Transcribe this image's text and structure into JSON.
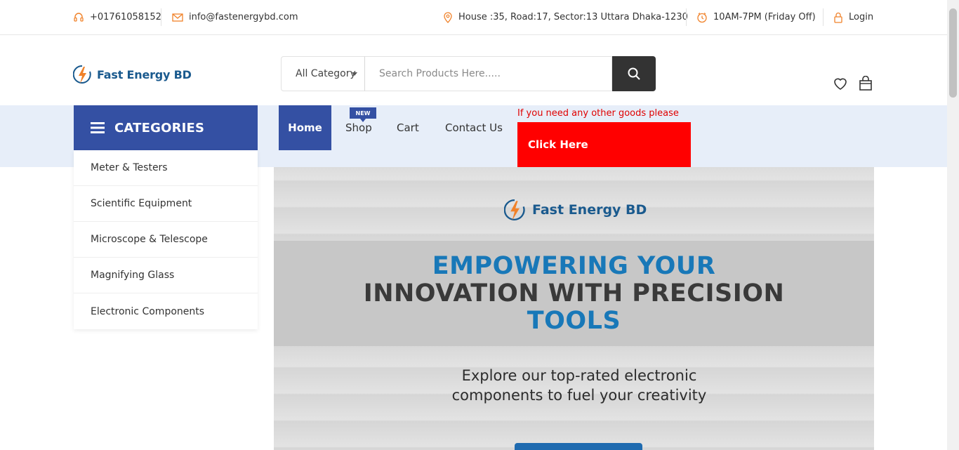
{
  "topbar": {
    "phone": "+01761058152",
    "email": "info@fastenergybd.com",
    "address": "House :35, Road:17, Sector:13 Uttara Dhaka-1230",
    "hours": "10AM-7PM (Friday Off)",
    "login": "Login"
  },
  "header": {
    "logo_text": "Fast Energy BD",
    "category_select": "All Category",
    "search_placeholder": "Search Products Here....."
  },
  "nav": {
    "categories_label": "CATEGORIES",
    "items": [
      "Home",
      "Shop",
      "Cart",
      "Contact Us"
    ],
    "new_badge": "NEW",
    "promo_text": "If you need any other goods please",
    "promo_button": "Click Here"
  },
  "categories": [
    "Meter & Testers",
    "Scientific Equipment",
    "Microscope & Telescope",
    "Magnifying Glass",
    "Electronic Components"
  ],
  "banner": {
    "logo_text": "Fast Energy BD",
    "headline_1": "EMPOWERING YOUR",
    "headline_2": "INNOVATION WITH PRECISION",
    "headline_3": "TOOLS",
    "subtext_1": "Explore our top-rated electronic",
    "subtext_2": "components to fuel your creativity"
  },
  "colors": {
    "brand_blue": "#3450a3",
    "nav_bg": "#e7eef9",
    "promo_red": "#ff0000",
    "accent_orange": "#f0822a"
  }
}
